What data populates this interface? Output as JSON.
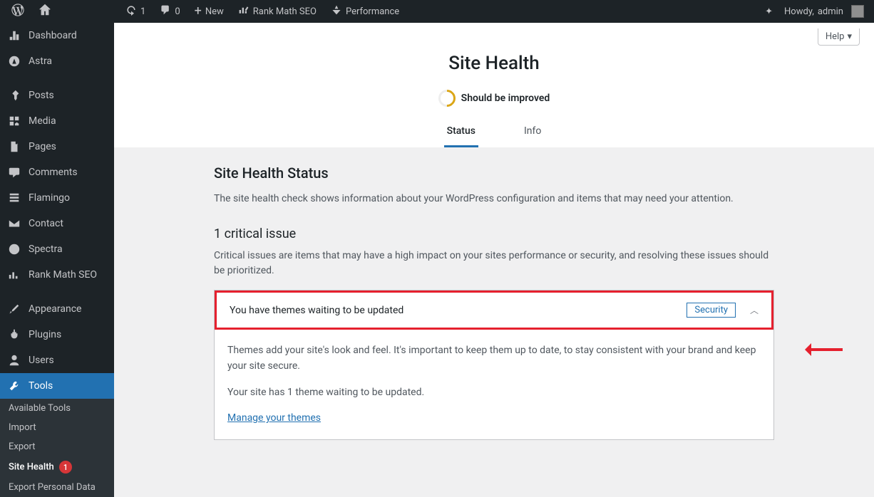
{
  "adminbar": {
    "updates_count": "1",
    "comments_count": "0",
    "new_label": "New",
    "rankmath_label": "Rank Math SEO",
    "performance_label": "Performance",
    "howdy_prefix": "Howdy, ",
    "username": "admin"
  },
  "sidebar": {
    "items": [
      {
        "label": "Dashboard",
        "icon": "dashboard"
      },
      {
        "label": "Astra",
        "icon": "astra"
      },
      {
        "sep": true
      },
      {
        "label": "Posts",
        "icon": "pin"
      },
      {
        "label": "Media",
        "icon": "media"
      },
      {
        "label": "Pages",
        "icon": "page"
      },
      {
        "label": "Comments",
        "icon": "comment"
      },
      {
        "label": "Flamingo",
        "icon": "flamingo"
      },
      {
        "label": "Contact",
        "icon": "mail"
      },
      {
        "label": "Spectra",
        "icon": "spectra"
      },
      {
        "label": "Rank Math SEO",
        "icon": "chart"
      },
      {
        "sep": true
      },
      {
        "label": "Appearance",
        "icon": "brush"
      },
      {
        "label": "Plugins",
        "icon": "plug"
      },
      {
        "label": "Users",
        "icon": "user"
      },
      {
        "label": "Tools",
        "icon": "wrench",
        "current": true
      }
    ],
    "submenu": [
      {
        "label": "Available Tools"
      },
      {
        "label": "Import"
      },
      {
        "label": "Export"
      },
      {
        "label": "Site Health",
        "current": true,
        "badge": "1"
      },
      {
        "label": "Export Personal Data"
      }
    ]
  },
  "content": {
    "help_label": "Help",
    "page_title": "Site Health",
    "indicator_text": "Should be improved",
    "tabs": {
      "status": "Status",
      "info": "Info"
    },
    "status_heading": "Site Health Status",
    "status_desc": "The site health check shows information about your WordPress configuration and items that may need your attention.",
    "critical_heading": "1 critical issue",
    "critical_desc": "Critical issues are items that may have a high impact on your sites performance or security, and resolving these issues should be prioritized.",
    "issue": {
      "title": "You have themes waiting to be updated",
      "badge": "Security",
      "body1": "Themes add your site's look and feel. It's important to keep them up to date, to stay consistent with your brand and keep your site secure.",
      "body2": "Your site has 1 theme waiting to be updated.",
      "link": "Manage your themes"
    }
  }
}
